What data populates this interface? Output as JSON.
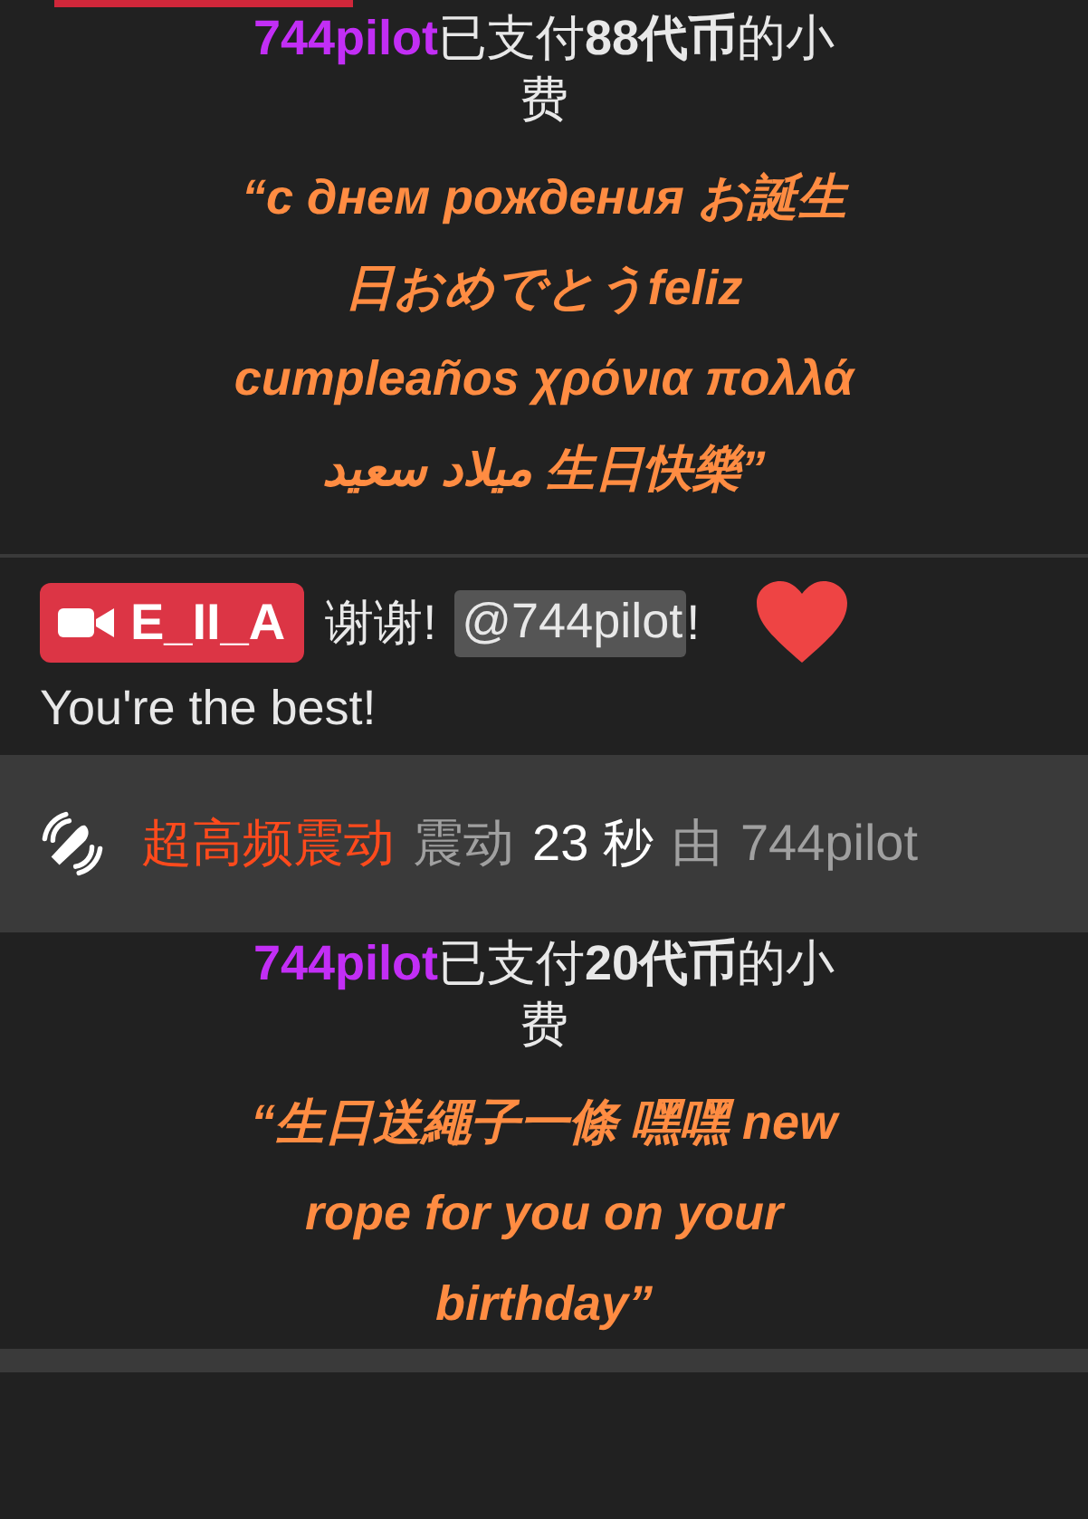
{
  "feed": [
    {
      "kind": "tip",
      "user": "744pilot",
      "action": "已支付**88代币**的小费",
      "quote": "“с днем рождения お誕生日おめでとうfeliz cumpleaños χρόνια πολλά ميلاد سعيد 生日快樂”"
    },
    {
      "kind": "message",
      "badge": "E_II_A",
      "text": "谢谢!",
      "mention": "@744pilot",
      "after": "!",
      "line2": "You're the best!"
    },
    {
      "kind": "vibration",
      "strength": "超高频震动",
      "verb": "震动",
      "duration": "23 秒",
      "by": "由",
      "user": "744pilot"
    },
    {
      "kind": "tip",
      "user": "744pilot",
      "action": "已支付**20代币**的小费",
      "quote": "“生日送繩子一條 嘿嘿 new rope for you on your birthday”"
    }
  ]
}
